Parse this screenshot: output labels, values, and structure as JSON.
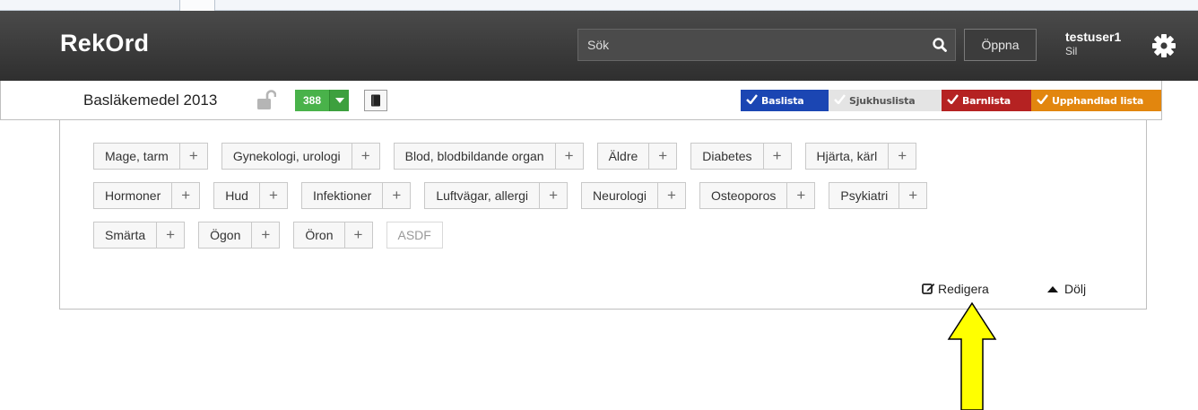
{
  "header": {
    "brand": "RekOrd",
    "search_placeholder": "Sök",
    "open_label": "Öppna",
    "user_name": "testuser1",
    "user_sub": "Sil"
  },
  "listbar": {
    "title": "Basläkemedel 2013",
    "count": "388",
    "flags": [
      {
        "label": "Baslista",
        "color": "#1b46b3"
      },
      {
        "label": "Sjukhuslista",
        "color": "#e4e4e4"
      },
      {
        "label": "Barnlista",
        "color": "#b52222"
      },
      {
        "label": "Upphandlad lista",
        "color": "#e2860e"
      }
    ]
  },
  "categories": {
    "rows": [
      [
        "Mage, tarm",
        "Gynekologi, urologi",
        "Blod, blodbildande organ",
        "Äldre",
        "Diabetes",
        "Hjärta, kärl"
      ],
      [
        "Hormoner",
        "Hud",
        "Infektioner",
        "Luftvägar, allergi",
        "Neurologi",
        "Osteoporos",
        "Psykiatri"
      ],
      [
        "Smärta",
        "Ögon",
        "Öron"
      ]
    ],
    "disabled_tag": "ASDF",
    "plus_symbol": "+"
  },
  "actions": {
    "edit_label": "Redigera",
    "hide_label": "Dölj"
  },
  "annotation": {
    "arrow_color": "#ffff00"
  }
}
